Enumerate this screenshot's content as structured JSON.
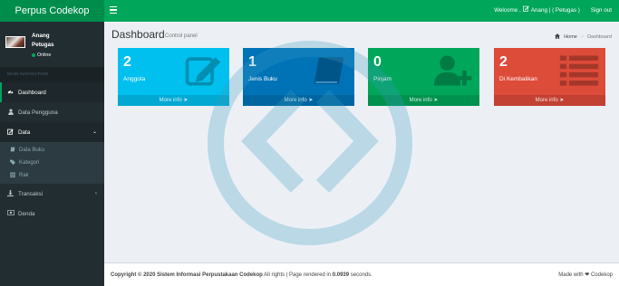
{
  "brand": "Perpus Codekop",
  "navbar": {
    "welcome": "Welcome ,",
    "user_label": "Anang | ( Petugas )",
    "signout": "Sign out"
  },
  "user": {
    "name": "Anang",
    "role": "Petugas",
    "status": "Online"
  },
  "sidebar": {
    "header": "MAIN NAVIGATION",
    "items": [
      {
        "label": "Dashboard",
        "icon": "dashboard-icon"
      },
      {
        "label": "Data Pengguna",
        "icon": "user-icon"
      },
      {
        "label": "Data",
        "icon": "edit-icon"
      },
      {
        "label": "Transaksi",
        "icon": "download-icon"
      },
      {
        "label": "Denda",
        "icon": "money-icon"
      }
    ],
    "submenu": [
      {
        "label": "Data Buku",
        "icon": "book-icon"
      },
      {
        "label": "Kategori",
        "icon": "tag-icon"
      },
      {
        "label": "Rak",
        "icon": "list-icon"
      }
    ]
  },
  "content": {
    "title": "Dashboard",
    "subtitle": "Control panel",
    "breadcrumb_home": "Home",
    "breadcrumb_current": "Dashboard"
  },
  "boxes": [
    {
      "value": "2",
      "label": "Anggota",
      "more": "More info",
      "color": "#00c0ef",
      "icon": "pencil-square-icon"
    },
    {
      "value": "1",
      "label": "Jenis Buku",
      "more": "More info",
      "color": "#0073b7",
      "icon": "book-icon"
    },
    {
      "value": "0",
      "label": "Pinjam",
      "more": "More info",
      "color": "#00a65a",
      "icon": "user-plus-icon"
    },
    {
      "value": "2",
      "label": "Di Kembalikan",
      "more": "More info",
      "color": "#dd4b39",
      "icon": "list-icon"
    }
  ],
  "footer": {
    "copyright": "Copyright © 2020 Sistem Informasi Perpustakaan Codekop",
    "rights": " All rights | Page rendered in ",
    "time": "0.0939",
    "seconds": " seconds.",
    "made_with": "Made with",
    "made_by": "Codekop"
  }
}
